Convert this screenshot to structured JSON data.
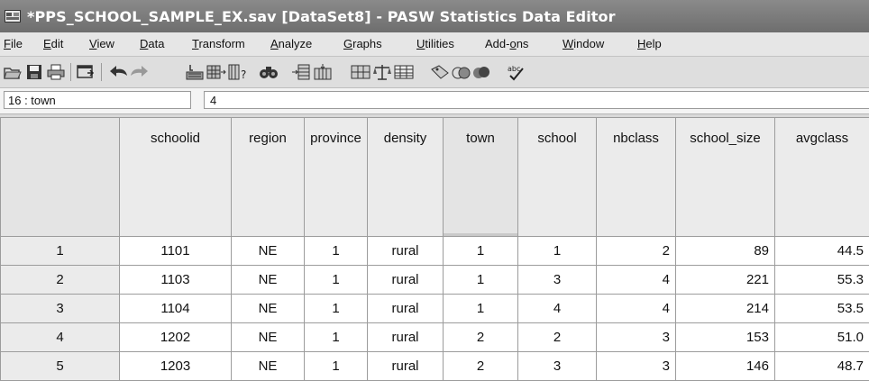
{
  "window": {
    "title": "*PPS_SCHOOL_SAMPLE_EX.sav [DataSet8] - PASW Statistics Data Editor"
  },
  "menu": [
    {
      "pre": "",
      "u": "F",
      "post": "ile"
    },
    {
      "pre": "",
      "u": "E",
      "post": "dit"
    },
    {
      "pre": "",
      "u": "V",
      "post": "iew"
    },
    {
      "pre": "",
      "u": "D",
      "post": "ata"
    },
    {
      "pre": "",
      "u": "T",
      "post": "ransform"
    },
    {
      "pre": "",
      "u": "A",
      "post": "nalyze"
    },
    {
      "pre": "",
      "u": "G",
      "post": "raphs"
    },
    {
      "pre": "",
      "u": "U",
      "post": "tilities"
    },
    {
      "pre": "Add-",
      "u": "o",
      "post": "ns"
    },
    {
      "pre": "",
      "u": "W",
      "post": "indow"
    },
    {
      "pre": "",
      "u": "H",
      "post": "elp"
    }
  ],
  "toolbar": {
    "icons": [
      "open-icon",
      "save-icon",
      "print-icon",
      "dialog-recall-icon",
      "undo-icon",
      "redo-icon",
      "goto-case-icon",
      "goto-variable-icon",
      "variables-icon",
      "find-icon",
      "insert-cases-icon",
      "insert-variable-icon",
      "split-file-icon",
      "weight-cases-icon",
      "select-cases-icon",
      "value-labels-icon",
      "use-sets-icon",
      "show-all-variables-icon",
      "spelling-icon"
    ]
  },
  "cell_editor": {
    "reference": "16 : town",
    "value": "4"
  },
  "grid": {
    "columns": [
      "schoolid",
      "region",
      "province",
      "density",
      "town",
      "school",
      "nbclass",
      "school_size",
      "avgclass"
    ],
    "rows": [
      {
        "n": "1",
        "cells": [
          "1101",
          "NE",
          "1",
          "rural",
          "1",
          "1",
          "2",
          "89",
          "44.5"
        ]
      },
      {
        "n": "2",
        "cells": [
          "1103",
          "NE",
          "1",
          "rural",
          "1",
          "3",
          "4",
          "221",
          "55.3"
        ]
      },
      {
        "n": "3",
        "cells": [
          "1104",
          "NE",
          "1",
          "rural",
          "1",
          "4",
          "4",
          "214",
          "53.5"
        ]
      },
      {
        "n": "4",
        "cells": [
          "1202",
          "NE",
          "1",
          "rural",
          "2",
          "2",
          "3",
          "153",
          "51.0"
        ]
      },
      {
        "n": "5",
        "cells": [
          "1203",
          "NE",
          "1",
          "rural",
          "2",
          "3",
          "3",
          "146",
          "48.7"
        ]
      }
    ]
  }
}
